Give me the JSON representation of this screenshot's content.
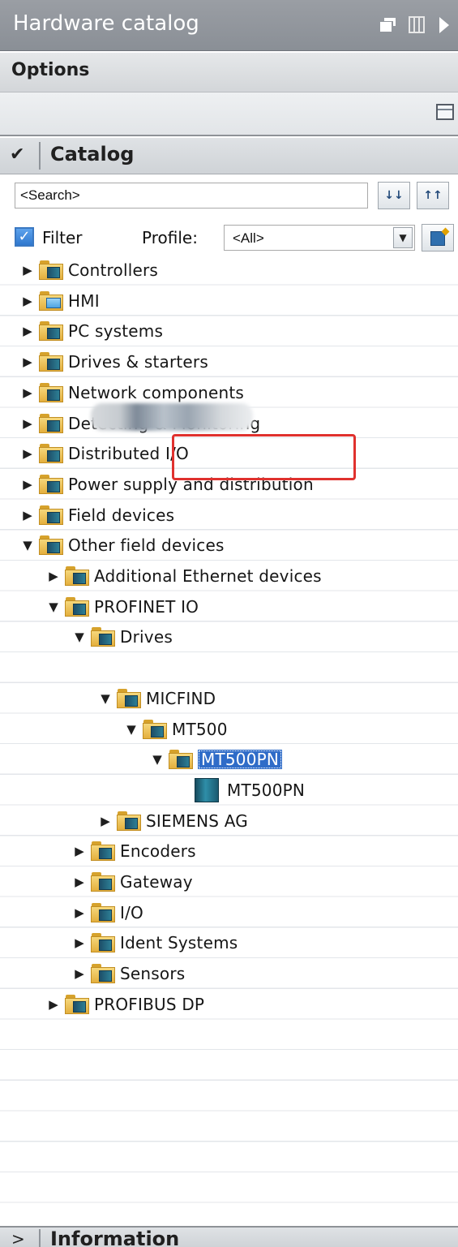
{
  "header": {
    "title": "Hardware catalog",
    "options_label": "Options"
  },
  "catalog": {
    "section_label": "Catalog",
    "search": {
      "value": "<Search>"
    },
    "filter": {
      "label": "Filter",
      "checked": true
    },
    "profile": {
      "label": "Profile:",
      "value": "<All>"
    }
  },
  "tree": {
    "items": [
      {
        "label": "Controllers",
        "depth": 0,
        "expanded": false,
        "icon": "folder-device-icon"
      },
      {
        "label": "HMI",
        "depth": 0,
        "expanded": false,
        "icon": "folder-hmi-icon"
      },
      {
        "label": "PC systems",
        "depth": 0,
        "expanded": false,
        "icon": "folder-device-icon"
      },
      {
        "label": "Drives & starters",
        "depth": 0,
        "expanded": false,
        "icon": "folder-device-icon"
      },
      {
        "label": "Network components",
        "depth": 0,
        "expanded": false,
        "icon": "folder-device-icon"
      },
      {
        "label": "Detecting & Monitoring",
        "depth": 0,
        "expanded": false,
        "icon": "folder-device-icon"
      },
      {
        "label": "Distributed I/O",
        "depth": 0,
        "expanded": false,
        "icon": "folder-device-icon"
      },
      {
        "label": "Power supply and distribution",
        "depth": 0,
        "expanded": false,
        "icon": "folder-device-icon"
      },
      {
        "label": "Field devices",
        "depth": 0,
        "expanded": false,
        "icon": "folder-device-icon"
      },
      {
        "label": "Other field devices",
        "depth": 0,
        "expanded": true,
        "icon": "folder-device-icon"
      },
      {
        "label": "Additional Ethernet devices",
        "depth": 1,
        "expanded": false,
        "icon": "folder-device-icon"
      },
      {
        "label": "PROFINET IO",
        "depth": 1,
        "expanded": true,
        "icon": "folder-device-icon"
      },
      {
        "label": "Drives",
        "depth": 2,
        "expanded": true,
        "icon": "folder-device-icon"
      },
      {
        "label": "MICFIND",
        "depth": 3,
        "expanded": true,
        "icon": "folder-device-icon"
      },
      {
        "label": "MT500",
        "depth": 4,
        "expanded": true,
        "icon": "folder-device-icon"
      },
      {
        "label": "MT500PN",
        "depth": 5,
        "expanded": true,
        "selected": true,
        "icon": "folder-device-icon"
      },
      {
        "label": "MT500PN",
        "depth": 6,
        "leaf": true,
        "icon": "device-icon"
      },
      {
        "label": "SIEMENS AG",
        "depth": 3,
        "expanded": false,
        "icon": "folder-device-icon"
      },
      {
        "label": "Encoders",
        "depth": 2,
        "expanded": false,
        "icon": "folder-device-icon"
      },
      {
        "label": "Gateway",
        "depth": 2,
        "expanded": false,
        "icon": "folder-device-icon"
      },
      {
        "label": "I/O",
        "depth": 2,
        "expanded": false,
        "icon": "folder-device-icon"
      },
      {
        "label": "Ident Systems",
        "depth": 2,
        "expanded": false,
        "icon": "folder-device-icon"
      },
      {
        "label": "Sensors",
        "depth": 2,
        "expanded": false,
        "icon": "folder-device-icon"
      },
      {
        "label": "PROFIBUS DP",
        "depth": 1,
        "expanded": false,
        "icon": "folder-device-icon"
      }
    ]
  },
  "information": {
    "label": "Information"
  },
  "colors": {
    "title_bar": "#8f949a",
    "selection": "#2f6cc8",
    "highlight_box": "#e0312e"
  }
}
